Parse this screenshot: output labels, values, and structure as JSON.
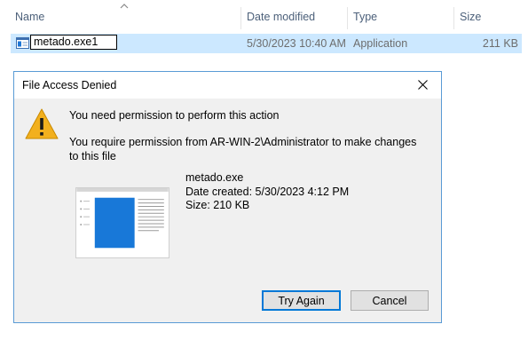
{
  "explorer": {
    "columns": {
      "name": "Name",
      "date_modified": "Date modified",
      "type": "Type",
      "size": "Size"
    },
    "file_row": {
      "rename_value": "metado.exe1",
      "date_modified": "5/30/2023 10:40 AM",
      "type": "Application",
      "size": "211 KB"
    }
  },
  "dialog": {
    "title": "File Access Denied",
    "message_primary": "You need permission to perform this action",
    "message_secondary": "You require permission from AR-WIN-2\\Administrator to make changes to this file",
    "file_name": "metado.exe",
    "date_created": "Date created: 5/30/2023 4:12 PM",
    "size": "Size: 210 KB",
    "buttons": {
      "try_again": "Try Again",
      "cancel": "Cancel"
    }
  },
  "colors": {
    "selection": "#cce8ff",
    "dialog_border": "#5a9bd5",
    "warning": "#f2b01e",
    "accent": "#0078d7"
  },
  "icons": [
    "sort-up-icon",
    "application-file-icon",
    "close-icon",
    "warning-icon",
    "file-thumbnail"
  ]
}
